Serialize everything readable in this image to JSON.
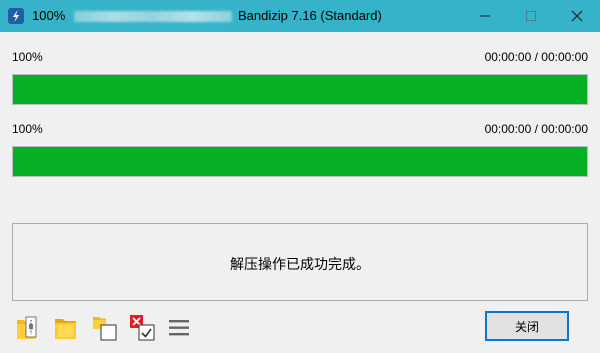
{
  "window": {
    "title_percent": "100%",
    "title": "Bandizip 7.16 (Standard)"
  },
  "progress": [
    {
      "percent_label": "100%",
      "time": "00:00:00 / 00:00:00",
      "value": 1.0
    },
    {
      "percent_label": "100%",
      "time": "00:00:00 / 00:00:00",
      "value": 1.0
    }
  ],
  "colors": {
    "titlebar": "#36b3c8",
    "progress_fill": "#06b025",
    "button_focus_border": "#0078d7"
  },
  "message": "解压操作已成功完成。",
  "toolbar": {
    "icons": [
      "open-folder-icon",
      "folder-icon",
      "copy-icon",
      "cancel-check-icon",
      "menu-icon"
    ],
    "close_label": "关闭"
  }
}
